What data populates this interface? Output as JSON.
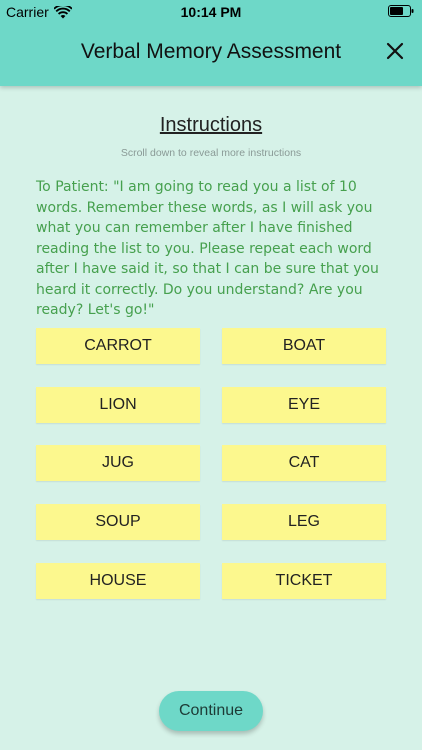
{
  "status_bar": {
    "carrier": "Carrier",
    "time": "10:14 PM",
    "wifi_icon": "wifi-icon",
    "battery_icon": "battery-icon"
  },
  "nav": {
    "title": "Verbal Memory Assessment",
    "close_icon": "close-icon"
  },
  "instructions": {
    "heading": "Instructions",
    "hint": "Scroll down to reveal more instructions",
    "patient_text": "To Patient: \"I am going to read you a list of 10 words. Remember these words, as I will ask you what you can remember after I have finished reading the list to you. Please repeat each word after I have said it, so that I can be sure that you heard it correctly. Do you understand? Are you ready? Let's go!\""
  },
  "words": [
    "CARROT",
    "BOAT",
    "LION",
    "EYE",
    "JUG",
    "CAT",
    "SOUP",
    "LEG",
    "HOUSE",
    "TICKET"
  ],
  "continue_label": "Continue",
  "colors": {
    "header": "#6ed8c8",
    "background": "#d6f2e8",
    "word_tile": "#fcf88e",
    "patient_text": "#46a04e"
  }
}
